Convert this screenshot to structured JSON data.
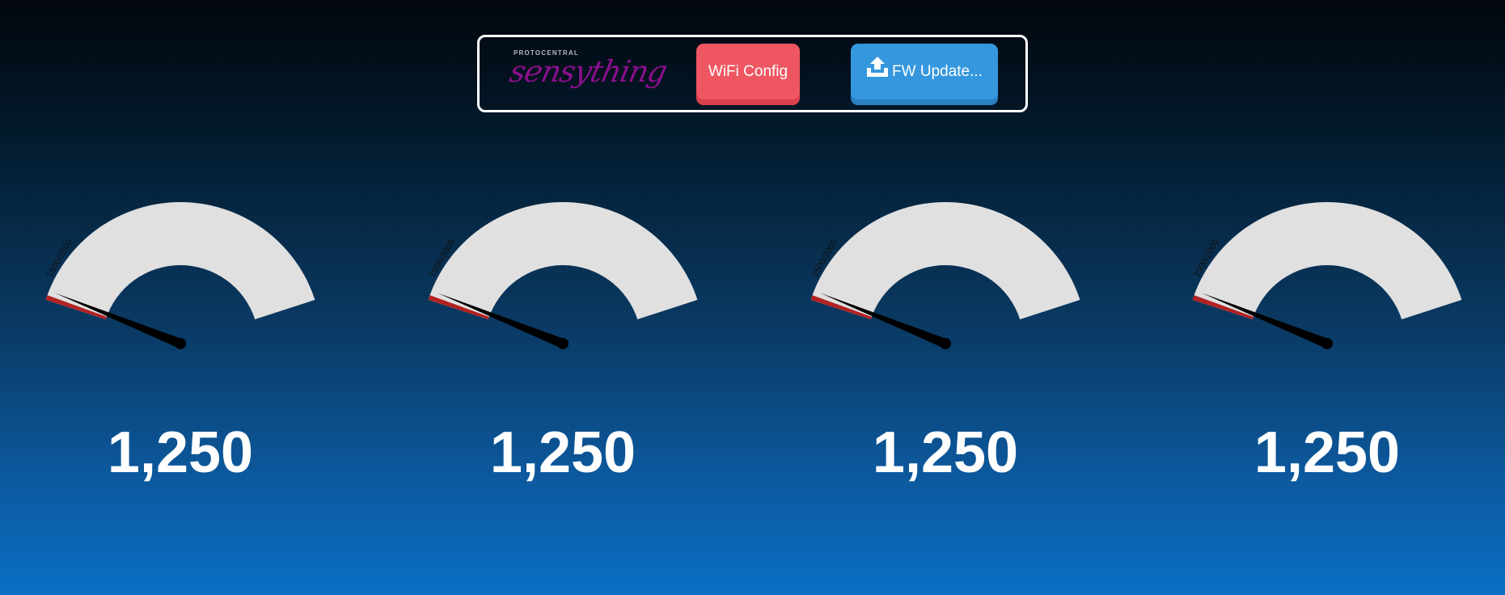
{
  "header": {
    "logo": {
      "brand": "PROTOCENTRAL",
      "product": "sensything"
    },
    "wifi_button": "WiFi Config",
    "fw_button": "FW Update...",
    "icons": {
      "fw_icon": "upload-icon"
    }
  },
  "colors": {
    "wifi_button": "#ee5762",
    "fw_button": "#3597de",
    "gauge_track": "#e0e0e0",
    "gauge_red": "#b22222",
    "needle": "#000000",
    "logo_script": "#8b0f8b"
  },
  "gauges": [
    {
      "value": "1,250",
      "label": "1500/2000"
    },
    {
      "value": "1,250",
      "label": "1500/2000"
    },
    {
      "value": "1,250",
      "label": "1500/2000"
    },
    {
      "value": "1,250",
      "label": "1500/2000"
    }
  ]
}
